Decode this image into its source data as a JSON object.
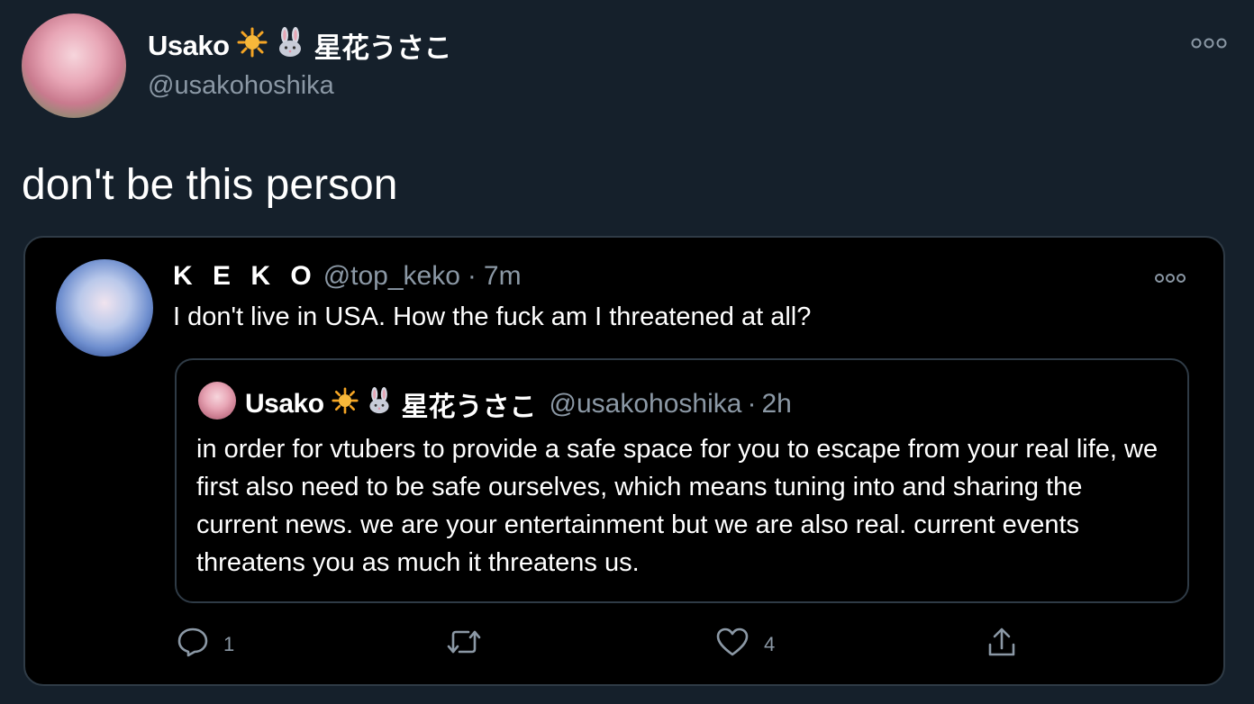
{
  "tweet": {
    "author_name": "Usako",
    "author_suffix": "星花うさこ",
    "author_handle": "@usakohoshika",
    "text": "don't be this person"
  },
  "quoted_tweet": {
    "author_name": "K E K O",
    "author_handle": "@top_keko",
    "separator": "·",
    "time": "7m",
    "text": "I don't live in USA. How the fuck am I threatened at all?",
    "nested": {
      "author_name": "Usako",
      "author_suffix": "星花うさこ",
      "author_handle": "@usakohoshika",
      "separator": "·",
      "time": "2h",
      "text": "in order for vtubers to provide a safe space for you to escape from your real life, we first also need to be safe ourselves, which means tuning into and sharing the current news. we are your entertainment but we are also real. current events threatens you as much it threatens us."
    },
    "actions": {
      "reply_count": "1",
      "like_count": "4"
    }
  },
  "icons": {
    "sun_emoji": "sun-icon",
    "rabbit_emoji": "rabbit-icon"
  },
  "colors": {
    "background": "#15202b",
    "card": "#000000",
    "muted": "#8b98a5",
    "border": "#2f3b46"
  }
}
